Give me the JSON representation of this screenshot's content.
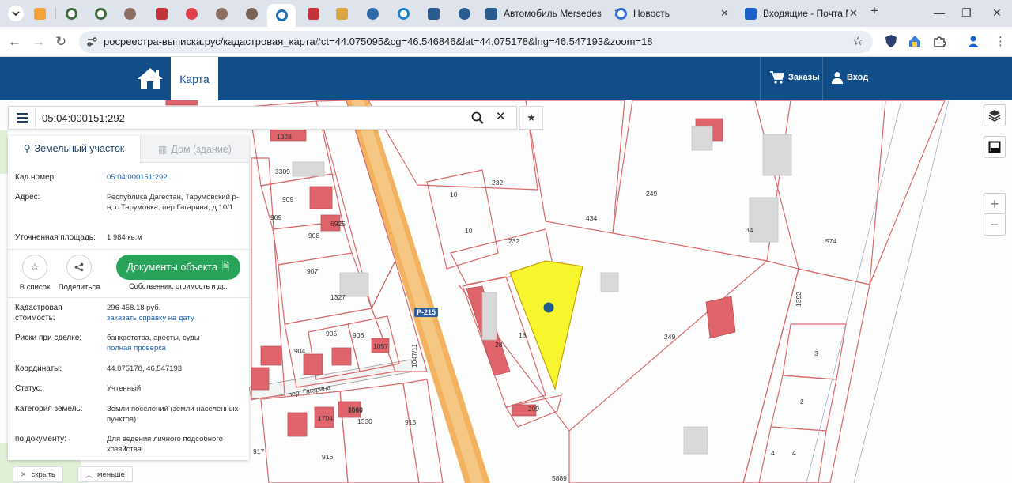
{
  "browser": {
    "tabs": [
      {
        "title": "Автомобиль Mersedes",
        "icon": "car-site-icon"
      },
      {
        "title": "Новость",
        "icon": "news-icon"
      },
      {
        "title": "Входящие - Почта Ma",
        "icon": "mail-icon"
      }
    ],
    "url": "росреестра-выписка.рус/кадастровая_карта#ct=44.075095&cg=46.546846&lat=44.075178&lng=46.547193&zoom=18"
  },
  "site": {
    "nav": {
      "map_tab": "Карта",
      "orders": "Заказы",
      "login": "Вход"
    }
  },
  "search": {
    "value": "05:04:000151:292"
  },
  "panel": {
    "tabs": {
      "land": "Земельный участок",
      "building": "Дом (здание)"
    },
    "cad_number": {
      "label": "Кад.номер:",
      "value": "05:04:000151:292"
    },
    "address": {
      "label": "Адрес:",
      "value": "Республика Дагестан, Тарумовский р-н, с Тарумовка, пер Гагарина, д 10/1"
    },
    "area": {
      "label": "Уточненная площадь:",
      "value": "1 984 кв.м"
    },
    "actions": {
      "add_to_list": "В список",
      "share": "Поделиться",
      "documents": "Документы объекта",
      "documents_sub": "Собственник, стоимость и др."
    },
    "cad_value": {
      "label": "Кадастровая стоимость:",
      "value": "296 458.18 руб.",
      "link": "заказать справку на дату"
    },
    "risks": {
      "label": "Риски при сделке:",
      "value": "банкротства, аресты, суды",
      "link": "полная проверка"
    },
    "coords": {
      "label": "Координаты:",
      "value": "44.075178, 46.547193"
    },
    "status": {
      "label": "Статус:",
      "value": "Учтенный"
    },
    "category": {
      "label": "Категория земель:",
      "value": "Земли поселений (земли населенных пунктов)"
    },
    "usage": {
      "label": "по документу:",
      "value": "Для ведения личного подсобного хозяйства"
    }
  },
  "map": {
    "road_label": "Р-215",
    "street_label": "пер. Гагарина",
    "plot_numbers": [
      "1328",
      "3309",
      "909",
      "909",
      "6925",
      "908",
      "907",
      "1327",
      "906",
      "905",
      "904",
      "1057",
      "1047/11",
      "1330",
      "915",
      "1059",
      "917",
      "916",
      "232",
      "10",
      "10",
      "232",
      "434",
      "249",
      "249",
      "34",
      "574",
      "1392",
      "3",
      "2",
      "4",
      "4",
      "28",
      "18",
      "209",
      "5889",
      "1704",
      "3560"
    ],
    "controls": {
      "zoom_in": "+",
      "zoom_out": "−"
    },
    "colors": {
      "selected_plot": "#f7f52e",
      "marker": "#1f5c91",
      "road": "#f2b25f",
      "boundary": "#d96a6a",
      "building": "#e0646b"
    }
  },
  "bottom": {
    "hide": "скрыть",
    "less": "меньше"
  }
}
